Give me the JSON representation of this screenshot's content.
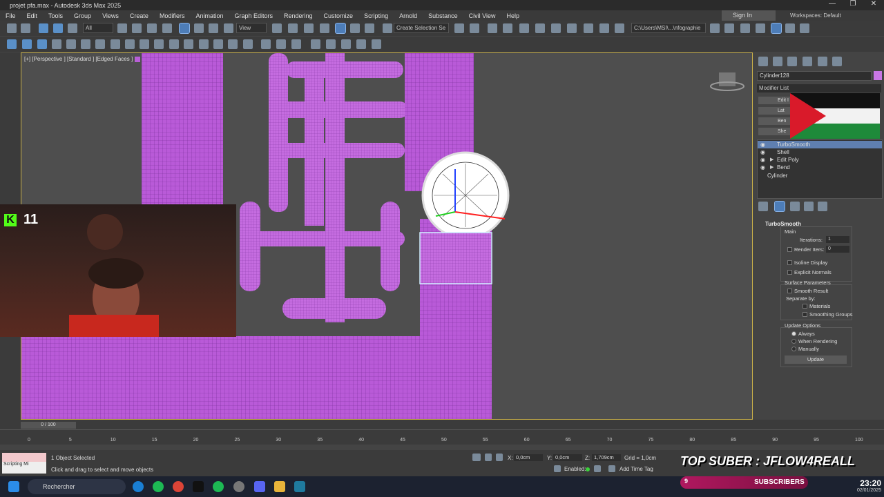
{
  "window": {
    "title": "projet pfa.max - Autodesk 3ds Max 2025",
    "controls": [
      "—",
      "❐",
      "✕"
    ]
  },
  "menu": [
    "File",
    "Edit",
    "Tools",
    "Group",
    "Views",
    "Create",
    "Modifiers",
    "Animation",
    "Graph Editors",
    "Rendering",
    "Customize",
    "Scripting",
    "Arnold",
    "Substance",
    "Civil View",
    "Help"
  ],
  "account": {
    "sign_in": "Sign In",
    "workspaces": "Workspaces: Default"
  },
  "toolbar": {
    "filter": "All",
    "view": "View",
    "create_selection_set": "Create Selection Se",
    "path": "C:\\Users\\MSI\\...\\nfographie"
  },
  "viewport": {
    "label": "[+] [Perspective ] [Standard ] [Edged Faces ]"
  },
  "overlay": {
    "kick_count": "11",
    "banner": "TOP SUBER : JFLOW4REALL",
    "subscribers_count": "9",
    "subscribers_label": "SUBSCRIBERS"
  },
  "command_panel": {
    "object_name": "Cylinder128",
    "object_color": "#c977e5",
    "modifier_list": "Modifier List",
    "preset_buttons": [
      "Edit I",
      "Lat",
      "Ben",
      "She"
    ],
    "stack": [
      {
        "name": "TurboSmooth",
        "selected": true
      },
      {
        "name": "Shell",
        "selected": false
      },
      {
        "name": "Edit Poly",
        "selected": false
      },
      {
        "name": "Bend",
        "selected": false
      },
      {
        "name": "Cylinder",
        "selected": false
      }
    ],
    "turbosmooth": {
      "title": "TurboSmooth",
      "main": "Main",
      "iterations_label": "Iterations:",
      "iterations_value": "1",
      "render_iters_label": "Render Iters:",
      "render_iters_value": "0",
      "isoline_display": "Isoline Display",
      "explicit_normals": "Explicit Normals",
      "surface_parameters": "Surface Parameters",
      "smooth_result": "Smooth Result",
      "separate_by": "Separate by:",
      "materials": "Materials",
      "smoothing_groups": "Smoothing Groups",
      "update_options": "Update Options",
      "always": "Always",
      "when_rendering": "When Rendering",
      "manually": "Manually",
      "update_button": "Update"
    }
  },
  "timeline": {
    "frame_box": "0 / 100",
    "ticks": [
      "0",
      "5",
      "10",
      "15",
      "20",
      "25",
      "30",
      "35",
      "40",
      "45",
      "50",
      "55",
      "60",
      "65",
      "70",
      "75",
      "80",
      "85",
      "90",
      "95",
      "100"
    ]
  },
  "status": {
    "mini_script": "Scripting Mi",
    "selected": "1 Object Selected",
    "prompt": "Click and drag to select and move objects",
    "x_label": "X:",
    "x_value": "0,0cm",
    "y_label": "Y:",
    "y_value": "0,0cm",
    "z_label": "Z:",
    "z_value": "1,709cm",
    "grid": "Grid = 1,0cm",
    "enabled": "Enabled:",
    "add_time_tag": "Add Time Tag"
  },
  "taskbar": {
    "search": "Rechercher",
    "time": "23:20",
    "date": "02/01/2025"
  }
}
